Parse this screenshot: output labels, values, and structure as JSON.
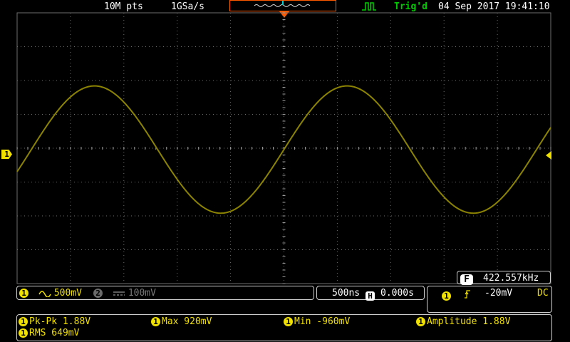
{
  "status_bar": {
    "memory_depth": "10M pts",
    "sample_rate": "1GSa/s",
    "trigger_status": "Trig'd",
    "datetime": "04 Sep 2017 19:41:10",
    "trigger_mode_icon": "edge-trigger-icon",
    "memory_overview_icon": "waveform-overview-icon"
  },
  "channel1": {
    "marker": "1",
    "coupling_icon": "ac-coupling-icon",
    "scale": "500mV",
    "trace_color": "#8c8400"
  },
  "channel2": {
    "marker": "2",
    "coupling_icon": "dc-coupling-icon",
    "scale": "100mV"
  },
  "timebase": {
    "scale": "500ns",
    "position_label": "H",
    "position": "0.000s"
  },
  "trigger": {
    "source": "1",
    "slope_icon": "rising-edge-icon",
    "level": "-20mV",
    "coupling": "DC"
  },
  "frequency_counter": {
    "label": "F",
    "value": "422.557kHz"
  },
  "measurements": [
    {
      "source": "1",
      "text": "Pk-Pk 1.88V"
    },
    {
      "source": "1",
      "text": "Max 920mV"
    },
    {
      "source": "1",
      "text": "Min -960mV"
    },
    {
      "source": "1",
      "text": "Amplitude 1.88V"
    },
    {
      "source": "1",
      "text": "RMS 649mV"
    }
  ],
  "colors": {
    "ch1": "#f1e100",
    "trigd": "#00c800",
    "trigger_marker": "#ff5a00",
    "grid": "#6e6e6e"
  }
}
